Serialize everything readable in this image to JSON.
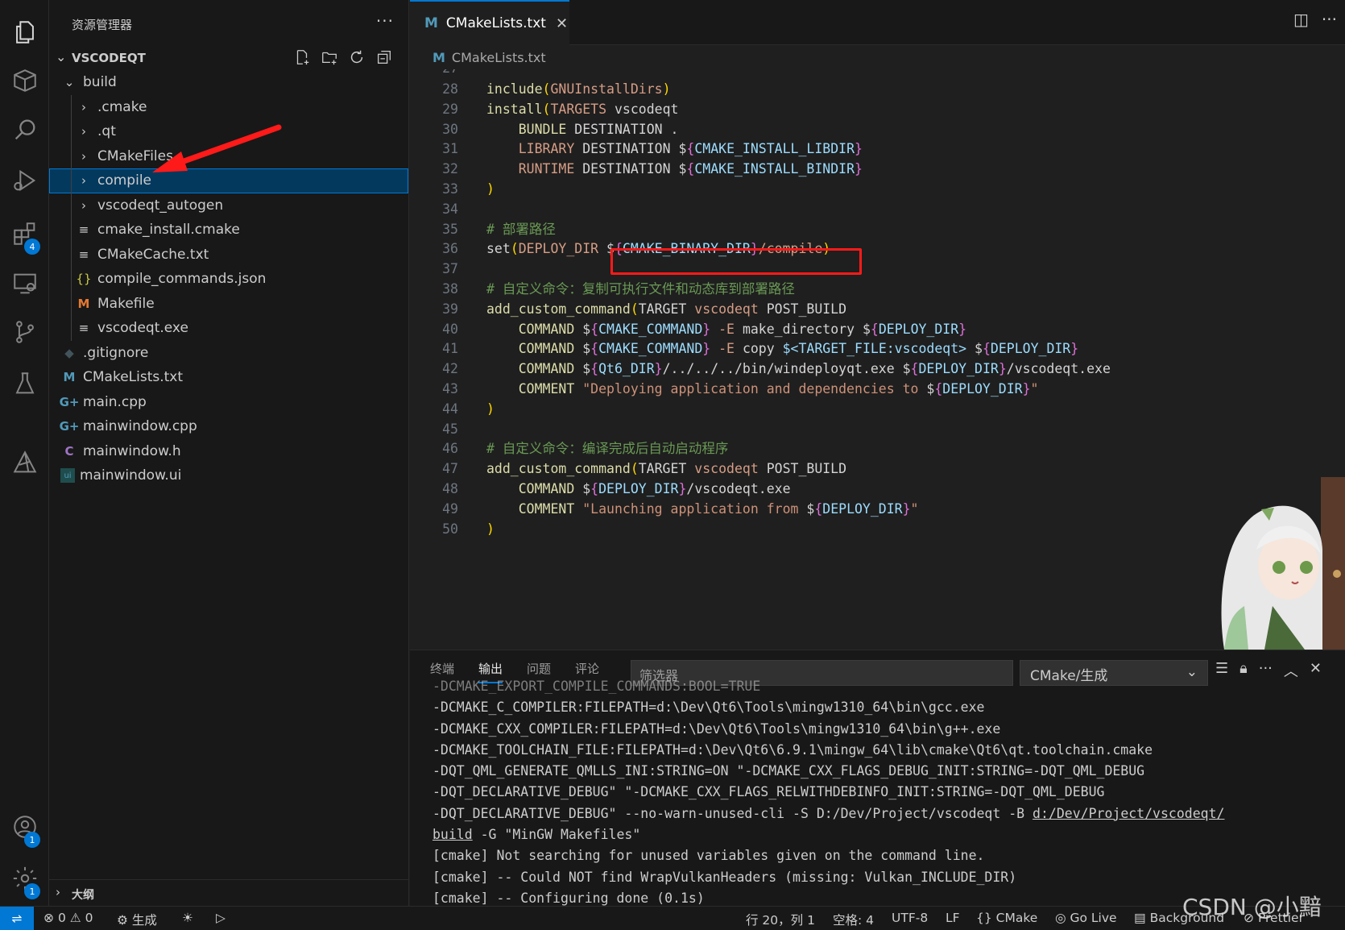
{
  "activity_bar": {
    "items": [
      "explorer",
      "extensions-box",
      "search",
      "run-debug",
      "extensions",
      "remote-explorer",
      "source-control",
      "testing",
      "cmake"
    ],
    "extensions_badge": "4",
    "accounts_badge": "1",
    "settings_badge": "1"
  },
  "sidebar": {
    "title": "资源管理器",
    "more": "···",
    "root": "VSCODEQT",
    "tree": [
      {
        "label": "build",
        "icon": "chevron-down",
        "indent": 1,
        "type": "folder-open"
      },
      {
        "label": ".cmake",
        "icon": "chevron-right",
        "indent": 2,
        "type": "folder"
      },
      {
        "label": ".qt",
        "icon": "chevron-right",
        "indent": 2,
        "type": "folder"
      },
      {
        "label": "CMakeFiles",
        "icon": "chevron-right",
        "indent": 2,
        "type": "folder"
      },
      {
        "label": "compile",
        "icon": "chevron-right",
        "indent": 2,
        "type": "folder",
        "selected": true
      },
      {
        "label": "vscodeqt_autogen",
        "icon": "chevron-right",
        "indent": 2,
        "type": "folder"
      },
      {
        "label": "cmake_install.cmake",
        "icon": "lines",
        "indent": 2,
        "type": "file"
      },
      {
        "label": "CMakeCache.txt",
        "icon": "lines",
        "indent": 2,
        "type": "file"
      },
      {
        "label": "compile_commands.json",
        "icon": "braces",
        "indent": 2,
        "type": "file"
      },
      {
        "label": "Makefile",
        "icon": "M",
        "indent": 2,
        "type": "file"
      },
      {
        "label": "vscodeqt.exe",
        "icon": "lines",
        "indent": 2,
        "type": "file"
      },
      {
        "label": ".gitignore",
        "icon": "diamond",
        "indent": 1,
        "type": "file"
      },
      {
        "label": "CMakeLists.txt",
        "icon": "M",
        "indent": 1,
        "type": "file"
      },
      {
        "label": "main.cpp",
        "icon": "G+",
        "indent": 1,
        "type": "file"
      },
      {
        "label": "mainwindow.cpp",
        "icon": "G+",
        "indent": 1,
        "type": "file"
      },
      {
        "label": "mainwindow.h",
        "icon": "C",
        "indent": 1,
        "type": "file"
      },
      {
        "label": "mainwindow.ui",
        "icon": "ui",
        "indent": 1,
        "type": "file"
      }
    ],
    "outline": "大纲"
  },
  "editor": {
    "tab": "CMakeLists.txt",
    "tab_icon": "M",
    "breadcrumb": "CMakeLists.txt",
    "first_partial_line": "27",
    "lines": [
      {
        "n": "28",
        "html": "<span class='k'>include</span><span class='p'>(</span><span class='c'>GNUInstallDirs</span><span class='p'>)</span>"
      },
      {
        "n": "29",
        "html": "<span class='k'>install</span><span class='p'>(</span><span class='c'>TARGETS</span> <span class='w'>vscodeqt</span>"
      },
      {
        "n": "30",
        "html": "    <span class='k'>BUNDLE</span> <span class='w'>DESTINATION .</span>"
      },
      {
        "n": "31",
        "html": "    <span class='c'>LIBRARY</span> <span class='w'>DESTINATION </span><span class='w'>$</span><span class='br'>{</span><span class='v'>CMAKE_INSTALL_LIBDIR</span><span class='br'>}</span>"
      },
      {
        "n": "32",
        "html": "    <span class='c'>RUNTIME</span> <span class='w'>DESTINATION </span><span class='w'>$</span><span class='br'>{</span><span class='v'>CMAKE_INSTALL_BINDIR</span><span class='br'>}</span>"
      },
      {
        "n": "33",
        "html": "<span class='p'>)</span>"
      },
      {
        "n": "34",
        "html": ""
      },
      {
        "n": "35",
        "html": "<span class='cm'># 部署路径</span>"
      },
      {
        "n": "36",
        "html": "<span class='w'>set</span><span class='p'>(</span><span class='c'>DEPLOY_DIR </span><span class='w'>$</span><span class='br'>{</span><span class='v'>CMAKE_BINARY_DIR</span><span class='br'>}</span><span class='c'>/compile</span><span class='p'>)</span>"
      },
      {
        "n": "37",
        "html": ""
      },
      {
        "n": "38",
        "html": "<span class='cm'># 自定义命令：复制可执行文件和动态库到部署路径</span>"
      },
      {
        "n": "39",
        "html": "<span class='k'>add_custom_command</span><span class='p'>(</span><span class='w'>TARGET </span><span class='c'>vscodeqt</span><span class='w'> POST_BUILD</span>"
      },
      {
        "n": "40",
        "html": "    <span class='k'>COMMAND</span> <span class='w'>$</span><span class='br'>{</span><span class='v'>CMAKE_COMMAND</span><span class='br'>}</span><span class='c'> -E </span><span class='w'>make_directory $</span><span class='br'>{</span><span class='v'>DEPLOY_DIR</span><span class='br'>}</span>"
      },
      {
        "n": "41",
        "html": "    <span class='k'>COMMAND</span> <span class='w'>$</span><span class='br'>{</span><span class='v'>CMAKE_COMMAND</span><span class='br'>}</span><span class='c'> -E </span><span class='w'>copy </span><span class='v'>$&lt;TARGET_FILE:vscodeqt&gt;</span><span class='w'> $</span><span class='br'>{</span><span class='v'>DEPLOY_DIR</span><span class='br'>}</span>"
      },
      {
        "n": "42",
        "html": "    <span class='k'>COMMAND</span> <span class='w'>$</span><span class='br'>{</span><span class='v'>Qt6_DIR</span><span class='br'>}</span><span class='w'>/../../../bin/windeployqt.exe $</span><span class='br'>{</span><span class='v'>DEPLOY_DIR</span><span class='br'>}</span><span class='w'>/vscodeqt.exe</span>"
      },
      {
        "n": "43",
        "html": "    <span class='k'>COMMENT</span> <span class='s'>\"Deploying application and dependencies to </span><span class='w'>$</span><span class='br'>{</span><span class='v'>DEPLOY_DIR</span><span class='br'>}</span><span class='s'>\"</span>"
      },
      {
        "n": "44",
        "html": "<span class='p'>)</span>"
      },
      {
        "n": "45",
        "html": ""
      },
      {
        "n": "46",
        "html": "<span class='cm'># 自定义命令：编译完成后自动启动程序</span>"
      },
      {
        "n": "47",
        "html": "<span class='k'>add_custom_command</span><span class='p'>(</span><span class='w'>TARGET </span><span class='c'>vscodeqt</span><span class='w'> POST_BUILD</span>"
      },
      {
        "n": "48",
        "html": "    <span class='k'>COMMAND</span> <span class='w'>$</span><span class='br'>{</span><span class='v'>DEPLOY_DIR</span><span class='br'>}</span><span class='w'>/vscodeqt.exe</span>"
      },
      {
        "n": "49",
        "html": "    <span class='k'>COMMENT</span> <span class='s'>\"Launching application from </span><span class='w'>$</span><span class='br'>{</span><span class='v'>DEPLOY_DIR</span><span class='br'>}</span><span class='s'>\"</span>"
      },
      {
        "n": "50",
        "html": "<span class='p'>)</span>"
      }
    ]
  },
  "panel": {
    "tabs": [
      "终端",
      "输出",
      "问题",
      "评论"
    ],
    "active": "输出",
    "filter_placeholder": "筛选器",
    "channel": "CMake/生成",
    "output": [
      "-DCMAKE_EXPORT_COMPILE_COMMANDS:BOOL=TRUE",
      "-DCMAKE_C_COMPILER:FILEPATH=d:\\Dev\\Qt6\\Tools\\mingw1310_64\\bin\\gcc.exe",
      "-DCMAKE_CXX_COMPILER:FILEPATH=d:\\Dev\\Qt6\\Tools\\mingw1310_64\\bin\\g++.exe",
      "-DCMAKE_TOOLCHAIN_FILE:FILEPATH=d:\\Dev\\Qt6\\6.9.1\\mingw_64\\lib\\cmake\\Qt6\\qt.toolchain.cmake",
      "-DQT_QML_GENERATE_QMLLS_INI:STRING=ON \"-DCMAKE_CXX_FLAGS_DEBUG_INIT:STRING=-DQT_QML_DEBUG",
      "-DQT_DECLARATIVE_DEBUG\" \"-DCMAKE_CXX_FLAGS_RELWITHDEBINFO_INIT:STRING=-DQT_QML_DEBUG",
      "-DQT_DECLARATIVE_DEBUG\" --no-warn-unused-cli -S D:/Dev/Project/vscodeqt -B d:/Dev/Project/vscodeqt/",
      "build -G \"MinGW Makefiles\"",
      "[cmake] Not searching for unused variables given on the command line.",
      "[cmake] -- Could NOT find WrapVulkanHeaders (missing: Vulkan_INCLUDE_DIR)",
      "[cmake] -- Configuring done (0.1s)"
    ]
  },
  "status": {
    "errors": "0",
    "warnings": "0",
    "build": "生成",
    "position": "行 20，列 1",
    "spaces": "空格: 4",
    "encoding": "UTF-8",
    "eol": "LF",
    "language": "CMake",
    "golive": "Go Live",
    "background": "Background",
    "prettier": "Prettier"
  },
  "watermark": "CSDN @小黯"
}
